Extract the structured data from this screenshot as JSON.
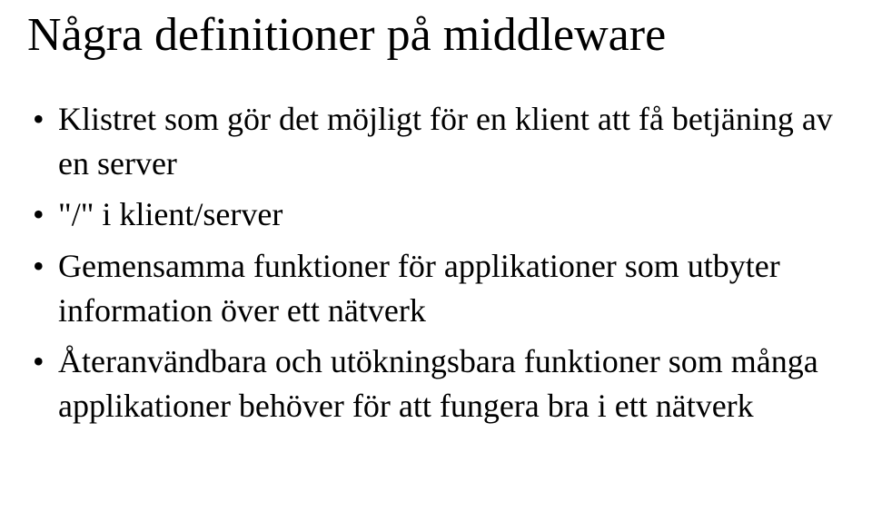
{
  "title": "Några definitioner på middleware",
  "bullets": [
    "Klistret som gör det möjligt för en klient att få betjäning av en server",
    "\"/\" i klient/server",
    "Gemensamma funktioner för applikationer som utbyter information över ett nätverk",
    "Återanvändbara och utökningsbara funktioner som många applikationer behöver för att fungera bra i ett nätverk"
  ]
}
